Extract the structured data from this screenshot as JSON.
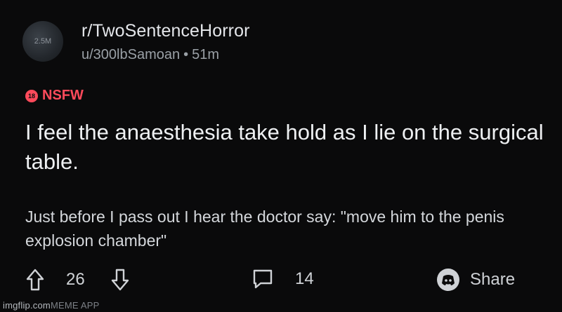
{
  "post": {
    "avatar_text": "2.5M",
    "subreddit": "r/TwoSentenceHorror",
    "author": "u/300lbSamoan",
    "time": "51m",
    "nsfw_badge": "18",
    "nsfw_label": "NSFW",
    "title": "I feel the anaesthesia take hold as I lie on the surgical table.",
    "body": "Just before I pass out I hear the doctor say: \"move him to the penis explosion chamber\""
  },
  "actions": {
    "vote_count": "26",
    "comment_count": "14",
    "share_label": "Share"
  },
  "watermark": {
    "imgflip": "imgflip.com",
    "app": "MEME APP"
  },
  "colors": {
    "background": "#0a0a0b",
    "nsfw": "#ff4a5b",
    "text": "#e4e6ea",
    "muted": "#9aa0a6"
  }
}
